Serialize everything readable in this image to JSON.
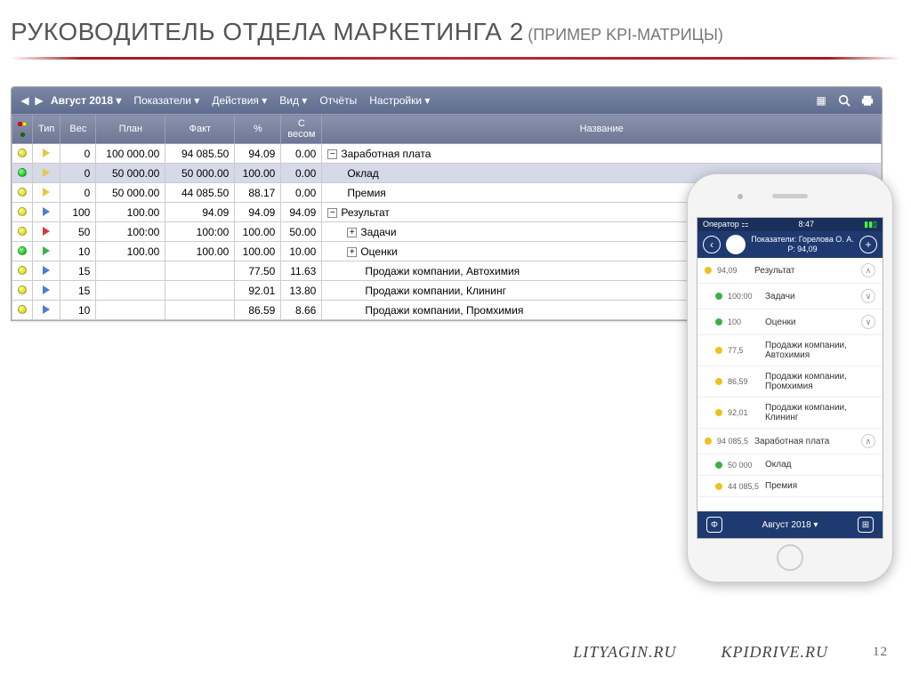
{
  "slide": {
    "title": "РУКОВОДИТЕЛЬ ОТДЕЛА МАРКЕТИНГА 2",
    "subtitle": "(ПРИМЕР KPI-МАТРИЦЫ)",
    "page": "12"
  },
  "toolbar": {
    "prev": "◀",
    "next": "▶",
    "period": "Август 2018 ▾",
    "menu": [
      "Показатели ▾",
      "Действия ▾",
      "Вид ▾",
      "Отчёты",
      "Настройки ▾"
    ]
  },
  "columns": {
    "lamp": "",
    "type": "Тип",
    "ves": "Вес",
    "plan": "План",
    "fakt": "Факт",
    "pct": "%",
    "sves": "С весом",
    "name": "Название"
  },
  "rows": [
    {
      "lamp": "yellow",
      "play": "yellow",
      "ves": "0",
      "plan": "100 000.00",
      "fakt": "94 085.50",
      "pct": "94.09",
      "sves": "0.00",
      "exp": "−",
      "name": "Заработная плата",
      "indent": 0
    },
    {
      "lamp": "green",
      "play": "yellow",
      "ves": "0",
      "plan": "50 000.00",
      "fakt": "50 000.00",
      "pct": "100.00",
      "sves": "0.00",
      "name": "Оклад",
      "indent": 1,
      "hl": true
    },
    {
      "lamp": "yellow",
      "play": "yellow",
      "ves": "0",
      "plan": "50 000.00",
      "fakt": "44 085.50",
      "pct": "88.17",
      "sves": "0.00",
      "name": "Премия",
      "indent": 1
    },
    {
      "lamp": "yellow",
      "play": "blue",
      "ves": "100",
      "plan": "100.00",
      "fakt": "94.09",
      "pct": "94.09",
      "sves": "94.09",
      "exp": "−",
      "name": "Результат",
      "indent": 0
    },
    {
      "lamp": "yellow",
      "play": "red",
      "ves": "50",
      "plan": "100:00",
      "fakt": "100:00",
      "pct": "100.00",
      "sves": "50.00",
      "exp": "+",
      "name": "Задачи",
      "indent": 1
    },
    {
      "lamp": "green",
      "play": "green",
      "ves": "10",
      "plan": "100.00",
      "fakt": "100.00",
      "pct": "100.00",
      "sves": "10.00",
      "exp": "+",
      "name": "Оценки",
      "indent": 1
    },
    {
      "lamp": "yellow",
      "play": "blue",
      "ves": "15",
      "plan": "",
      "fakt": "",
      "pct": "77.50",
      "sves": "11.63",
      "name": "Продажи компании, Автохимия",
      "indent": 2
    },
    {
      "lamp": "yellow",
      "play": "blue",
      "ves": "15",
      "plan": "",
      "fakt": "",
      "pct": "92.01",
      "sves": "13.80",
      "name": "Продажи компании, Клининг",
      "indent": 2
    },
    {
      "lamp": "yellow",
      "play": "blue",
      "ves": "10",
      "plan": "",
      "fakt": "",
      "pct": "86.59",
      "sves": "8.66",
      "name": "Продажи компании, Промхимия",
      "indent": 2
    }
  ],
  "phone": {
    "operator": "Оператор",
    "time": "8:47",
    "title1": "Показатели: Горелова О. А.",
    "title2": "Р: 94,09",
    "rows": [
      {
        "dot": "y",
        "val": "94,09",
        "name": "Результат",
        "chev": "∧",
        "sub": false
      },
      {
        "dot": "g",
        "val": "100:00",
        "name": "Задачи",
        "chev": "∨",
        "sub": true
      },
      {
        "dot": "g",
        "val": "100",
        "name": "Оценки",
        "chev": "∨",
        "sub": true
      },
      {
        "dot": "y",
        "val": "77,5",
        "name": "Продажи компании, Автохимия",
        "sub": true
      },
      {
        "dot": "y",
        "val": "86,59",
        "name": "Продажи компании, Промхимия",
        "sub": true
      },
      {
        "dot": "y",
        "val": "92,01",
        "name": "Продажи компании, Клининг",
        "sub": true
      },
      {
        "dot": "y",
        "val": "94 085,5",
        "name": "Заработная плата",
        "chev": "∧",
        "sub": false
      },
      {
        "dot": "g",
        "val": "50 000",
        "name": "Оклад",
        "sub": true
      },
      {
        "dot": "y",
        "val": "44 085,5",
        "name": "Премия",
        "sub": true
      }
    ],
    "footer_period": "Август 2018 ▾"
  },
  "footer": {
    "site1": "LITYAGIN.RU",
    "site2": "KPIDRIVE.RU"
  }
}
